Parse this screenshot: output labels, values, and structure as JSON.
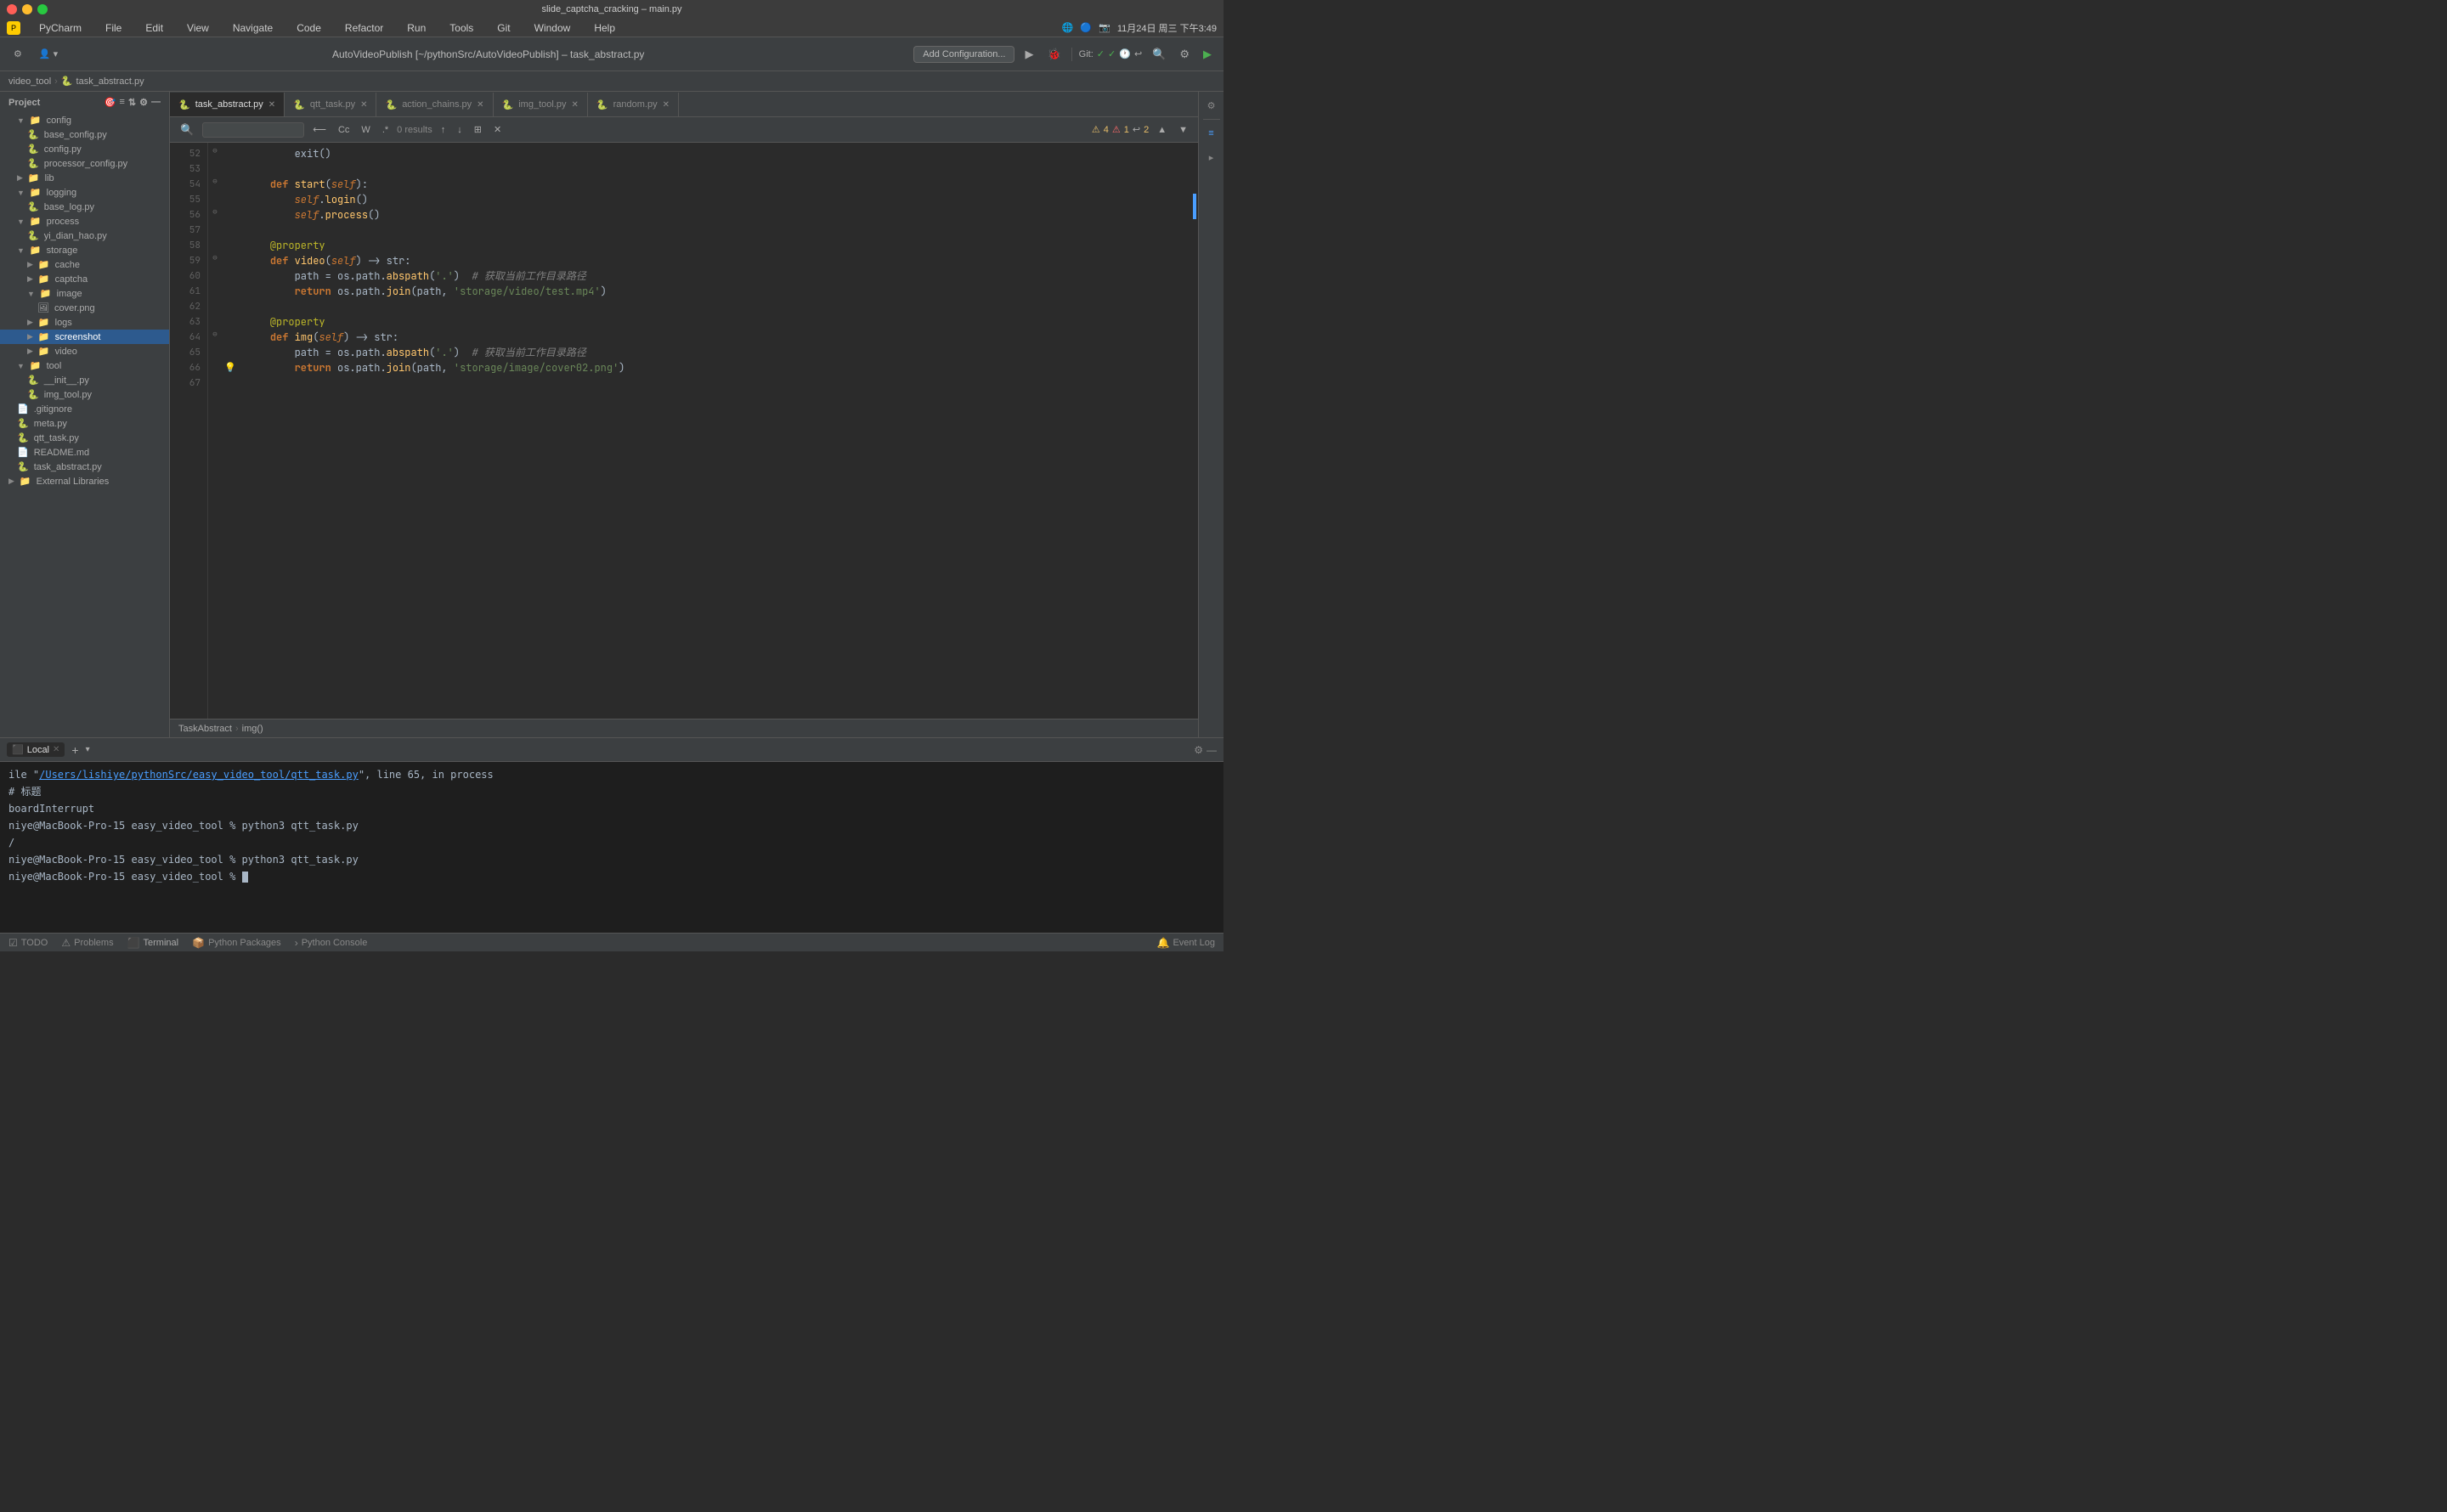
{
  "titlebar": {
    "title": "slide_captcha_cracking – main.py"
  },
  "menubar": {
    "app": "PyCharm",
    "items": [
      "File",
      "Edit",
      "View",
      "Navigate",
      "Code",
      "Refactor",
      "Run",
      "Tools",
      "Git",
      "Window",
      "Help"
    ]
  },
  "toolbar": {
    "title": "AutoVideoPublish [~/pythonSrc/AutoVideoPublish] – task_abstract.py",
    "add_config_label": "Add Configuration...",
    "git_label": "Git:",
    "settings_icon": "⚙",
    "run_icon": "▶",
    "debug_icon": "🐛"
  },
  "breadcrumb": {
    "project": "video_tool",
    "file": "task_abstract.py"
  },
  "sidebar": {
    "header": "Project",
    "items": [
      {
        "label": "config",
        "type": "folder",
        "indent": 1,
        "expanded": true
      },
      {
        "label": "base_config.py",
        "type": "file",
        "indent": 2
      },
      {
        "label": "config.py",
        "type": "file",
        "indent": 2
      },
      {
        "label": "processor_config.py",
        "type": "file",
        "indent": 2
      },
      {
        "label": "lib",
        "type": "folder",
        "indent": 1,
        "expanded": false
      },
      {
        "label": "logging",
        "type": "folder",
        "indent": 1,
        "expanded": true
      },
      {
        "label": "base_log.py",
        "type": "file",
        "indent": 2
      },
      {
        "label": "process",
        "type": "folder",
        "indent": 1,
        "expanded": true
      },
      {
        "label": "yi_dian_hao.py",
        "type": "file",
        "indent": 2
      },
      {
        "label": "storage",
        "type": "folder",
        "indent": 1,
        "expanded": true
      },
      {
        "label": "cache",
        "type": "folder",
        "indent": 2
      },
      {
        "label": "captcha",
        "type": "folder",
        "indent": 2
      },
      {
        "label": "image",
        "type": "folder",
        "indent": 2,
        "expanded": true
      },
      {
        "label": "cover.png",
        "type": "file",
        "indent": 3
      },
      {
        "label": "logs",
        "type": "folder",
        "indent": 2
      },
      {
        "label": "screenshot",
        "type": "folder",
        "indent": 2,
        "selected": true
      },
      {
        "label": "video",
        "type": "folder",
        "indent": 2
      },
      {
        "label": "tool",
        "type": "folder",
        "indent": 1,
        "expanded": true
      },
      {
        "label": "__init__.py",
        "type": "file",
        "indent": 2
      },
      {
        "label": "img_tool.py",
        "type": "file",
        "indent": 2
      },
      {
        "label": ".gitignore",
        "type": "file",
        "indent": 1
      },
      {
        "label": "meta.py",
        "type": "file",
        "indent": 1
      },
      {
        "label": "qtt_task.py",
        "type": "file",
        "indent": 1
      },
      {
        "label": "README.md",
        "type": "file",
        "indent": 1
      },
      {
        "label": "task_abstract.py",
        "type": "file",
        "indent": 1
      },
      {
        "label": "External Libraries",
        "type": "folder",
        "indent": 0,
        "expanded": false
      }
    ]
  },
  "tabs": [
    {
      "label": "task_abstract.py",
      "active": true,
      "icon": "py"
    },
    {
      "label": "qtt_task.py",
      "active": false,
      "icon": "py"
    },
    {
      "label": "action_chains.py",
      "active": false,
      "icon": "py"
    },
    {
      "label": "img_tool.py",
      "active": false,
      "icon": "py"
    },
    {
      "label": "random.py",
      "active": false,
      "icon": "py"
    }
  ],
  "search": {
    "placeholder": "",
    "results": "0 results"
  },
  "code": {
    "lines": [
      {
        "num": 52,
        "content": "        exit()",
        "has_fold": true
      },
      {
        "num": 53,
        "content": ""
      },
      {
        "num": 54,
        "content": "    def start(self):",
        "has_fold": true
      },
      {
        "num": 55,
        "content": "        self.login()"
      },
      {
        "num": 56,
        "content": "        self.process()",
        "has_fold": true
      },
      {
        "num": 57,
        "content": ""
      },
      {
        "num": 58,
        "content": "    @property",
        "has_fold": false
      },
      {
        "num": 59,
        "content": "    def video(self) -> str:",
        "has_fold": true
      },
      {
        "num": 60,
        "content": "        path = os.path.abspath('.')  # 获取当前工作目录路径",
        "has_fold": false
      },
      {
        "num": 61,
        "content": "        return os.path.join(path, 'storage/video/test.mp4')",
        "has_fold": false
      },
      {
        "num": 62,
        "content": ""
      },
      {
        "num": 63,
        "content": "    @property",
        "has_fold": false
      },
      {
        "num": 64,
        "content": "    def img(self) -> str:",
        "has_fold": true
      },
      {
        "num": 65,
        "content": "        path = os.path.abspath('.')  # 获取当前工作目录路径",
        "has_fold": false
      },
      {
        "num": 66,
        "content": "        return os.path.join(path, 'storage/image/cover02.png')",
        "has_hint": true
      },
      {
        "num": 67,
        "content": ""
      }
    ]
  },
  "code_breadcrumb": {
    "class": "TaskAbstract",
    "method": "img()"
  },
  "terminal": {
    "tabs": [
      {
        "label": "Local",
        "active": true
      }
    ],
    "lines": [
      {
        "text": "ile \"/Users/lishiye/pythonSrc/easy_video_tool/qtt_task.py\", line 65, in process",
        "type": "error"
      },
      {
        "text": "# 标题",
        "type": "comment"
      },
      {
        "text": "boardInterrupt",
        "type": "error"
      },
      {
        "text": "",
        "type": "normal"
      },
      {
        "text": "niye@MacBook-Pro-15 easy_video_tool % python3 qtt_task.py",
        "type": "prompt"
      },
      {
        "text": "/",
        "type": "normal"
      },
      {
        "text": "niye@MacBook-Pro-15 easy_video_tool % python3 qtt_task.py",
        "type": "prompt"
      },
      {
        "text": "",
        "type": "normal"
      },
      {
        "text": "niye@MacBook-Pro-15 easy_video_tool %",
        "type": "prompt-cursor"
      }
    ]
  },
  "status_bar": {
    "items": [
      {
        "label": "TODO",
        "icon": "☑"
      },
      {
        "label": "Problems",
        "icon": "⚠"
      },
      {
        "label": "Terminal",
        "icon": "⬛",
        "active": true
      },
      {
        "label": "Python Packages",
        "icon": "📦"
      },
      {
        "label": "Python Console",
        "icon": ">"
      },
      {
        "label": "Event Log",
        "icon": "🔔"
      }
    ]
  },
  "warnings": {
    "warning_count": "4",
    "error_count": "1",
    "info_count": "2"
  }
}
